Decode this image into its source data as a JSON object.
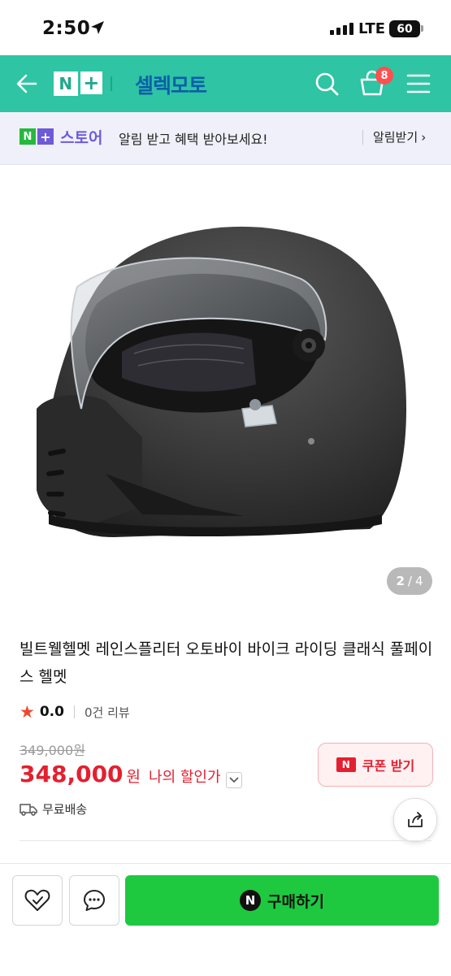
{
  "status_bar": {
    "time": "2:50",
    "network": "LTE",
    "battery": "60"
  },
  "header": {
    "brand": "셀렉모토",
    "nplus_n": "N",
    "nplus_plus": "+",
    "cart_count": "8"
  },
  "promo": {
    "logo_n": "N",
    "logo_plus": "+",
    "store": "스토어",
    "text": "알림 받고 혜택 받아보세요!",
    "alarm_label": "알림받기",
    "alarm_chevron": "›"
  },
  "gallery": {
    "current": "2",
    "separator": "/",
    "total": "4"
  },
  "product": {
    "title": "빌트웰헬멧 레인스플리터 오토바이 바이크 라이딩 클래식 풀페이스 헬멧",
    "rating": "0.0",
    "review_count": "0건 리뷰",
    "original_price": "349,000원",
    "price": "348,000",
    "currency": "원",
    "my_price_label": "나의 할인가",
    "coupon_badge": "N",
    "coupon_label": "쿠폰 받기",
    "shipping": "무료배송"
  },
  "bottom_bar": {
    "buy_label": "구매하기",
    "buy_badge": "N"
  },
  "colors": {
    "header_bg": "#2ec4a4",
    "brand_blue": "#0b5fa8",
    "price_red": "#e3202f",
    "buy_green": "#1ec93f",
    "store_purple": "#6f5bd8"
  }
}
